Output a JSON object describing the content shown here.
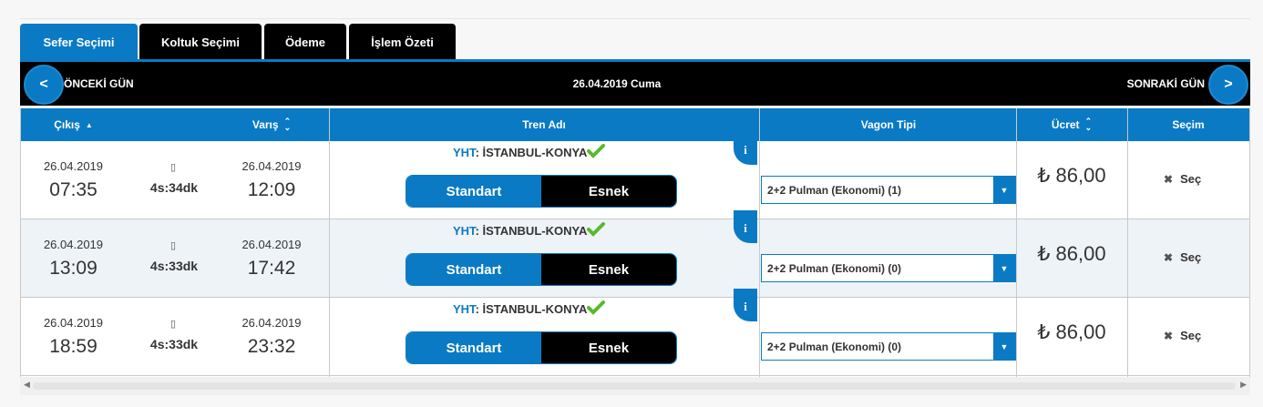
{
  "tabs": [
    "Sefer Seçimi",
    "Koltuk Seçimi",
    "Ödeme",
    "İşlem Özeti"
  ],
  "daybar": {
    "prev_symbol": "<",
    "prev_label": "ÖNCEKİ GÜN",
    "date": "26.04.2019 Cuma",
    "next_label": "SONRAKİ GÜN",
    "next_symbol": ">"
  },
  "headers": {
    "departure": "Çıkış",
    "arrival": "Varış",
    "train": "Tren Adı",
    "wagon": "Vagon Tipi",
    "fare": "Ücret",
    "selection": "Seçim"
  },
  "rows": [
    {
      "dep_date": "26.04.2019",
      "dep_time": "07:35",
      "duration": "4s:34dk",
      "arr_date": "26.04.2019",
      "arr_time": "12:09",
      "train_type": "YHT",
      "route": ": İSTANBUL-KONYA",
      "option_standard": "Standart",
      "option_flex": "Esnek",
      "wagon": "2+2 Pulman (Ekonomi) (1)",
      "price": "₺ 86,00",
      "select": "Seç"
    },
    {
      "dep_date": "26.04.2019",
      "dep_time": "13:09",
      "duration": "4s:33dk",
      "arr_date": "26.04.2019",
      "arr_time": "17:42",
      "train_type": "YHT",
      "route": ": İSTANBUL-KONYA",
      "option_standard": "Standart",
      "option_flex": "Esnek",
      "wagon": "2+2 Pulman (Ekonomi) (0)",
      "price": "₺ 86,00",
      "select": "Seç"
    },
    {
      "dep_date": "26.04.2019",
      "dep_time": "18:59",
      "duration": "4s:33dk",
      "arr_date": "26.04.2019",
      "arr_time": "23:32",
      "train_type": "YHT",
      "route": ": İSTANBUL-KONYA",
      "option_standard": "Standart",
      "option_flex": "Esnek",
      "wagon": "2+2 Pulman (Ekonomi) (0)",
      "price": "₺ 86,00",
      "select": "Seç"
    }
  ],
  "info_symbol": "i",
  "train_icon_glyph": "▯",
  "colors": {
    "accent": "#0a7ac4",
    "bar": "#000000",
    "check": "#5cb82e"
  }
}
